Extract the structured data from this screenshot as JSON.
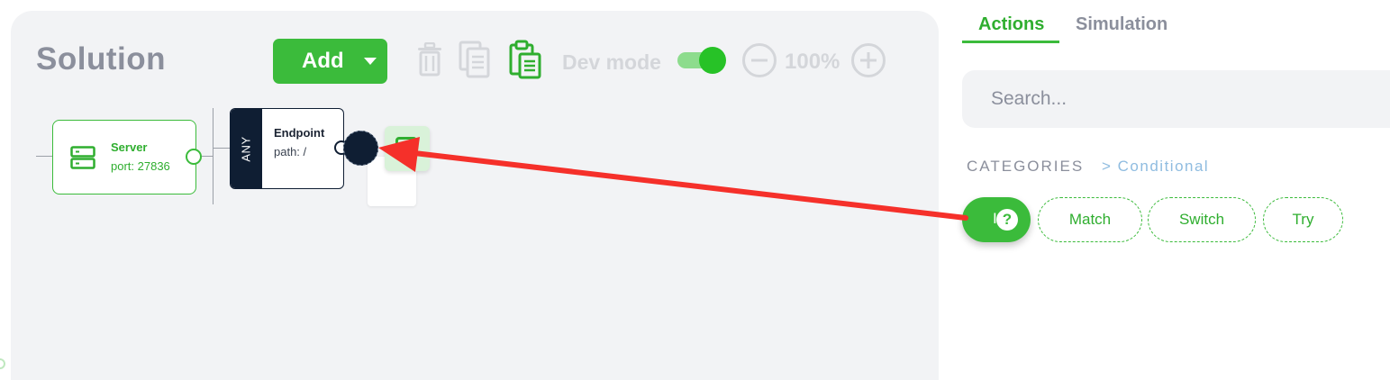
{
  "canvas": {
    "title": "Solution",
    "add_button": "Add",
    "dev_mode_label": "Dev mode",
    "dev_mode_on": true,
    "zoom": "100%"
  },
  "nodes": {
    "server": {
      "name": "Server",
      "port": "port: 27836"
    },
    "endpoint": {
      "method": "ANY",
      "name": "Endpoint",
      "path": "path: /"
    }
  },
  "panel": {
    "tabs": [
      {
        "label": "Actions",
        "active": true
      },
      {
        "label": "Simulation",
        "active": false
      }
    ],
    "search_placeholder": "Search...",
    "categories_label": "CATEGORIES",
    "breadcrumb": "> Conditional",
    "chips": [
      "I",
      "Match",
      "Switch",
      "Try"
    ]
  },
  "colors": {
    "accent": "#3bbb3b",
    "node_dark": "#0f1e33",
    "annotation_arrow": "#f5302a"
  },
  "icons": [
    "trash-icon",
    "copy-icon",
    "paste-icon",
    "zoom-out-icon",
    "zoom-in-icon",
    "server-icon",
    "help-icon"
  ]
}
